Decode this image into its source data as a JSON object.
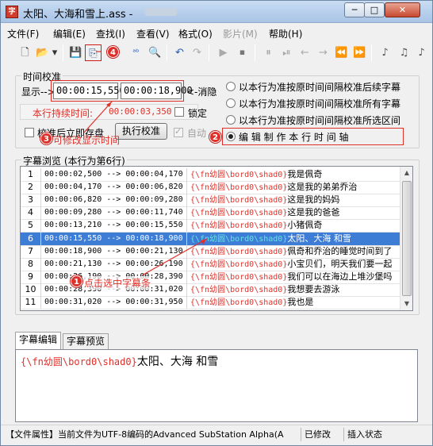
{
  "window": {
    "title": "太阳、大海和雪上.ass - ",
    "app_icon": "subtitle-app-icon",
    "minimize_label": "─",
    "maximize_label": "□",
    "close_label": "✕"
  },
  "menu": [
    {
      "label": "文件(F)",
      "enabled": true
    },
    {
      "label": "编辑(E)",
      "enabled": true
    },
    {
      "label": "查找(I)",
      "enabled": true
    },
    {
      "label": "查看(V)",
      "enabled": true
    },
    {
      "label": "格式(O)",
      "enabled": true
    },
    {
      "label": "影片(M)",
      "enabled": false
    },
    {
      "label": "帮助(H)",
      "enabled": true
    }
  ],
  "toolbar": {
    "buttons": [
      {
        "name": "new-file-icon",
        "glyph": "🗋"
      },
      {
        "name": "open-folder-icon",
        "glyph": "📂"
      },
      {
        "name": "dropdown-arrow-icon",
        "glyph": "▾"
      },
      {
        "name": "save-icon",
        "glyph": "💾"
      },
      {
        "name": "save-copy-icon",
        "glyph": "⎘"
      },
      {
        "name": "replace-icon",
        "glyph": "ᵃᵇ"
      },
      {
        "name": "find-icon",
        "glyph": "🔍"
      },
      {
        "name": "undo-icon",
        "glyph": "↶"
      },
      {
        "name": "redo-icon",
        "glyph": "↷"
      },
      {
        "name": "play-icon",
        "glyph": "▶"
      },
      {
        "name": "timeline-icon",
        "glyph": "⏹"
      },
      {
        "name": "pause-icon",
        "glyph": "⏸"
      },
      {
        "name": "stop-icon",
        "glyph": "⏯"
      },
      {
        "name": "prev-icon",
        "glyph": "←"
      },
      {
        "name": "next-icon",
        "glyph": "→"
      },
      {
        "name": "rewind-icon",
        "glyph": "⏪"
      },
      {
        "name": "forward-icon",
        "glyph": "⏩"
      },
      {
        "name": "music-note-icon",
        "glyph": "♪"
      },
      {
        "name": "music-note-off-icon",
        "glyph": "♫"
      }
    ]
  },
  "time_group": {
    "title": "时间校准",
    "display_label": "显示-->",
    "start_time": "00:00:15,550",
    "end_time": "00:00:18,900",
    "hide_label": "<-消隐",
    "duration_label": "本行持续时间:",
    "duration_value": "00:00:03,350",
    "lock_label": "锁定",
    "after_calibrate_label": "校准后立即存盘",
    "calibrate_button": "执行校准",
    "auto_label": "自动",
    "radio_options": [
      {
        "label": "以本行为准按原时间间隔校准后续字幕",
        "selected": false
      },
      {
        "label": "以本行为准按原时间间隔校准所有字幕",
        "selected": false
      },
      {
        "label": "以本行为准按原时间间隔校准所选区间",
        "selected": false
      },
      {
        "label": "编  辑  制  作  本  行  时  间  轴",
        "selected": true
      }
    ]
  },
  "annotations": {
    "badge1": "1",
    "badge2": "2",
    "badge3": "3",
    "badge4": "4",
    "text1": "点击选中字幕条",
    "text3": "可修改显示时间"
  },
  "browser": {
    "title": "字幕浏览 (本行为第6行)",
    "rows": [
      {
        "num": "1",
        "time": "00:00:02,500 --> 00:00:04,170",
        "tag": "{\\fn幼圆\\bord0\\shad0}",
        "text": "我是佩奇",
        "selected": false
      },
      {
        "num": "2",
        "time": "00:00:04,170 --> 00:00:06,820",
        "tag": "{\\fn幼圆\\bord0\\shad0}",
        "text": "这是我的弟弟乔治",
        "selected": false
      },
      {
        "num": "3",
        "time": "00:00:06,820 --> 00:00:09,280",
        "tag": "{\\fn幼圆\\bord0\\shad0}",
        "text": "这是我的妈妈",
        "selected": false
      },
      {
        "num": "4",
        "time": "00:00:09,280 --> 00:00:11,740",
        "tag": "{\\fn幼圆\\bord0\\shad0}",
        "text": "这是我的爸爸",
        "selected": false
      },
      {
        "num": "5",
        "time": "00:00:13,210 --> 00:00:15,550",
        "tag": "{\\fn幼圆\\bord0\\shad0}",
        "text": "小猪佩奇",
        "selected": false
      },
      {
        "num": "6",
        "time": "00:00:15,550 --> 00:00:18,900",
        "tag": "{\\fn幼圆\\bord0\\shad0}",
        "text": "太阳、大海 和雪",
        "selected": true
      },
      {
        "num": "7",
        "time": "00:00:18,900 --> 00:00:21,130",
        "tag": "{\\fn幼圆\\bord0\\shad0}",
        "text": "佩奇和乔治的睡觉时间到了",
        "selected": false
      },
      {
        "num": "8",
        "time": "00:00:21,130 --> 00:00:26,190",
        "tag": "{\\fn幼圆\\bord0\\shad0}",
        "text": "小宝贝们，明天我们要一起",
        "selected": false
      },
      {
        "num": "9",
        "time": "00:00:26,190 --> 00:00:28,390",
        "tag": "{\\fn幼圆\\bord0\\shad0}",
        "text": "我们可以在海边上堆沙堡吗",
        "selected": false
      },
      {
        "num": "10",
        "time": "00:00:28,390 --> 00:00:31,020",
        "tag": "{\\fn幼圆\\bord0\\shad0}",
        "text": "我想要去游泳",
        "selected": false
      },
      {
        "num": "11",
        "time": "00:00:31,020 --> 00:00:31,950",
        "tag": "{\\fn幼圆\\bord0\\shad0}",
        "text": "我也是",
        "selected": false
      }
    ]
  },
  "tabs": [
    {
      "label": "字幕编辑",
      "active": true
    },
    {
      "label": "字幕预览",
      "active": false
    }
  ],
  "editor": {
    "tag": "{\\fn幼圆\\bord0\\shad0}",
    "text": "太阳、大海 和雪"
  },
  "status": {
    "file_props": "【文件属性】当前文件为UTF-8编码的Advanced SubStation Alpha(A",
    "modified": "已修改",
    "insert_mode": "插入状态"
  },
  "colors": {
    "annotation_red": "#e0302a",
    "selection_blue": "#3e7dd6",
    "tag_red": "#e0302a",
    "tag_selected_cyan": "#67e3e3"
  }
}
